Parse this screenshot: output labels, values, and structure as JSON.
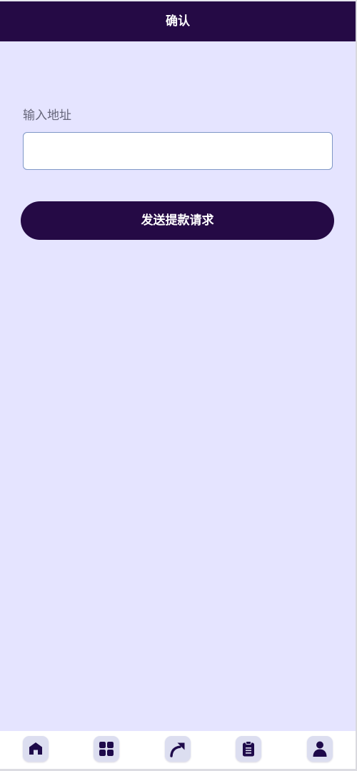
{
  "header": {
    "title": "确认"
  },
  "form": {
    "address_label": "输入地址",
    "address_value": "",
    "submit_label": "发送提款请求"
  },
  "tabbar": {
    "items": [
      {
        "icon": "home-icon"
      },
      {
        "icon": "grid-icon"
      },
      {
        "icon": "share-arrow-icon"
      },
      {
        "icon": "clipboard-icon"
      },
      {
        "icon": "user-icon"
      }
    ]
  },
  "colors": {
    "header_bg": "#250a45",
    "page_bg": "#e5e4ff",
    "button_bg": "#250a45",
    "tab_bg": "#dcdef0",
    "icon_color": "#1e0a4a"
  }
}
